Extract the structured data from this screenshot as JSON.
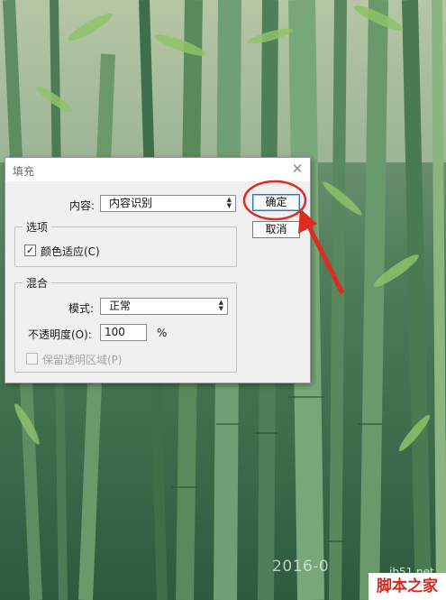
{
  "photo": {
    "date_stamp": "2016-0",
    "site": "jb51.net",
    "watermark": "脚本之家"
  },
  "dialog": {
    "title": "填充",
    "close_glyph": "✕",
    "content_label": "内容:",
    "content_value": "内容识别",
    "ok_label": "确定",
    "cancel_label": "取消",
    "options": {
      "group_title": "选项",
      "color_adapt_label": "颜色适应(C)",
      "color_adapt_checked": true
    },
    "blending": {
      "group_title": "混合",
      "mode_label": "模式:",
      "mode_value": "正常",
      "opacity_label": "不透明度(O):",
      "opacity_value": "100",
      "opacity_unit": "%",
      "preserve_label": "保留透明区域(P)",
      "preserve_checked": false,
      "preserve_enabled": false
    }
  },
  "annotation": {
    "color": "#e02a22"
  }
}
